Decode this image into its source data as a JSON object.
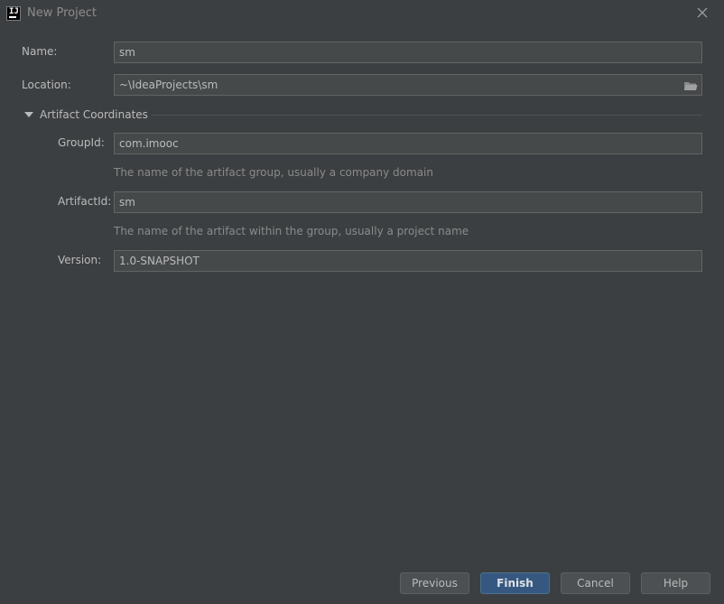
{
  "window": {
    "title": "New Project",
    "icon": "intellij-idea-icon"
  },
  "form": {
    "name_label": "Name:",
    "name_value": "sm",
    "location_label": "Location:",
    "location_value": "~\\IdeaProjects\\sm",
    "section_title": "Artifact Coordinates",
    "group_label": "GroupId:",
    "group_value": "com.imooc",
    "group_hint": "The name of the artifact group, usually a company domain",
    "artifact_label": "ArtifactId:",
    "artifact_value": "sm",
    "artifact_hint": "The name of the artifact within the group, usually a project name",
    "version_label": "Version:",
    "version_value": "1.0-SNAPSHOT"
  },
  "buttons": {
    "previous": "Previous",
    "finish": "Finish",
    "cancel": "Cancel",
    "help": "Help"
  },
  "colors": {
    "background": "#3c3f41",
    "field_background": "#45494a",
    "primary_button": "#365880"
  }
}
